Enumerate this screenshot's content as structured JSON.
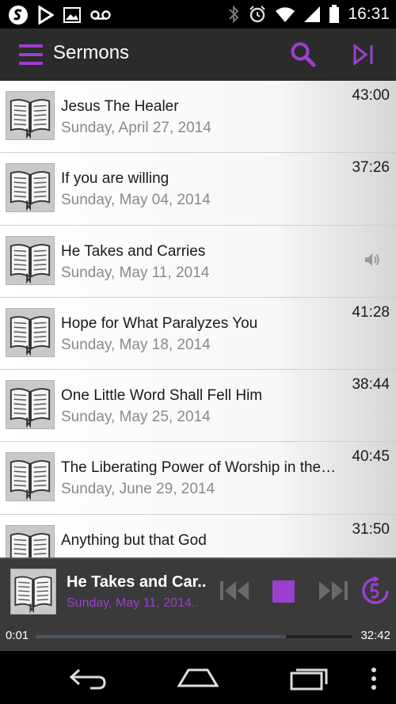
{
  "status_bar": {
    "time": "16:31",
    "left_icons": [
      "s-app-icon",
      "play-store-icon",
      "image-icon",
      "voicemail-icon"
    ],
    "right_icons": [
      "bluetooth-icon",
      "alarm-icon",
      "wifi-icon",
      "signal-icon",
      "battery-icon"
    ]
  },
  "action_bar": {
    "title": "Sermons",
    "menu_icon": "menu-icon",
    "search_icon": "search-icon",
    "queue_icon": "play-queue-icon",
    "accent": "#9b3fd1"
  },
  "sermons": [
    {
      "title": "Jesus The Healer",
      "date": "Sunday, April 27, 2014",
      "duration": "43:00",
      "playing": false
    },
    {
      "title": "If you are willing",
      "date": "Sunday, May 04, 2014",
      "duration": "37:26",
      "playing": false
    },
    {
      "title": "He Takes and Carries",
      "date": "Sunday, May 11, 2014",
      "duration": "",
      "playing": true
    },
    {
      "title": "Hope for What Paralyzes You",
      "date": "Sunday, May 18, 2014",
      "duration": "41:28",
      "playing": false
    },
    {
      "title": "One Little Word Shall Fell Him",
      "date": "Sunday, May 25, 2014",
      "duration": "38:44",
      "playing": false
    },
    {
      "title": "The Liberating Power of Worship in the…",
      "date": "Sunday, June 29, 2014",
      "duration": "40:45",
      "playing": false
    },
    {
      "title": "Anything but that God",
      "date": "",
      "duration": "31:50",
      "playing": false
    }
  ],
  "player": {
    "title": "He Takes and Car..",
    "date": "Sunday, May 11, 2014..",
    "current_time": "0:01",
    "total_time": "32:42",
    "progress_fraction": 0.79,
    "controls": [
      "previous-icon",
      "stop-icon",
      "next-icon",
      "skip-5-icon"
    ]
  },
  "nav_bar": {
    "icons": [
      "back-icon",
      "home-icon",
      "recent-apps-icon",
      "overflow-menu-icon"
    ]
  }
}
